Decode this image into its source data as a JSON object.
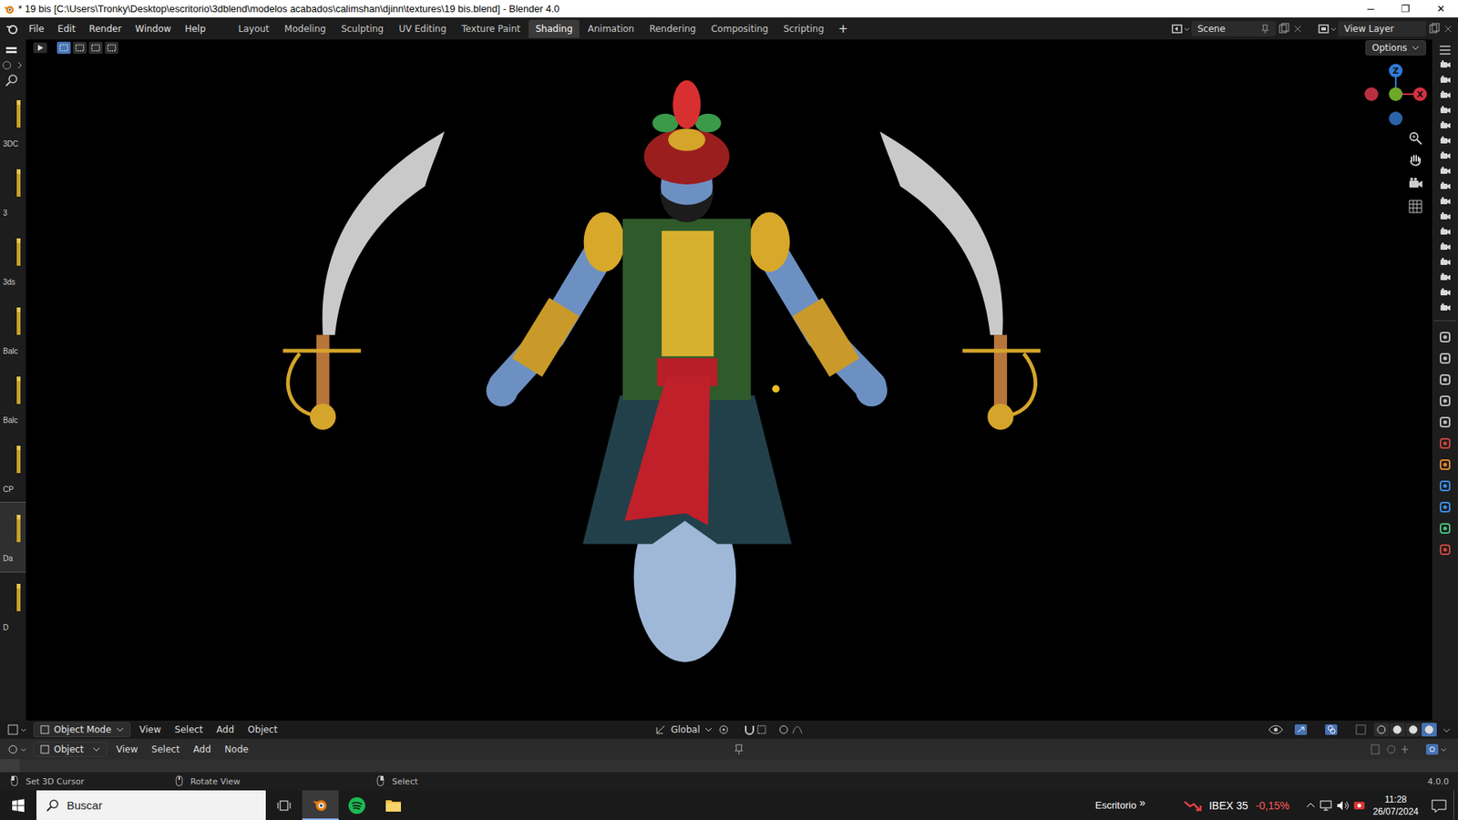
{
  "window": {
    "title": "* 19 bis [C:\\Users\\Tronky\\Desktop\\escritorio\\3dblend\\modelos acabados\\calimshan\\djinn\\textures\\19 bis.blend] - Blender 4.0",
    "controls": [
      "─",
      "❐",
      "✕"
    ]
  },
  "menu": [
    "File",
    "Edit",
    "Render",
    "Window",
    "Help"
  ],
  "workspaces": [
    {
      "label": "Layout",
      "selected": false
    },
    {
      "label": "Modeling",
      "selected": false
    },
    {
      "label": "Sculpting",
      "selected": false
    },
    {
      "label": "UV Editing",
      "selected": false
    },
    {
      "label": "Texture Paint",
      "selected": false
    },
    {
      "label": "Shading",
      "selected": true
    },
    {
      "label": "Animation",
      "selected": false
    },
    {
      "label": "Rendering",
      "selected": false
    },
    {
      "label": "Compositing",
      "selected": false
    },
    {
      "label": "Scripting",
      "selected": false
    }
  ],
  "add_workspace": "+",
  "scene": "Scene",
  "view_layer": "View Layer",
  "file_strip": [
    {
      "label": "3DC",
      "selected": false
    },
    {
      "label": "3",
      "selected": false
    },
    {
      "label": "3ds",
      "selected": false
    },
    {
      "label": "Balc",
      "selected": false
    },
    {
      "label": "Balc",
      "selected": false
    },
    {
      "label": "CP",
      "selected": false
    },
    {
      "label": "Da",
      "selected": true
    },
    {
      "label": "D",
      "selected": false
    }
  ],
  "viewport": {
    "options": "Options",
    "gizmo": {
      "z": "Z",
      "x": "X"
    }
  },
  "viewport_header": {
    "mode": "Object Mode",
    "menus": [
      "View",
      "Select",
      "Add",
      "Object"
    ],
    "orientation": "Global"
  },
  "node_header": {
    "mode": "Object",
    "menus": [
      "View",
      "Select",
      "Add",
      "Node"
    ]
  },
  "status_bar": {
    "hints": [
      "Set 3D Cursor",
      "Rotate View",
      "Select"
    ],
    "version": "4.0.0"
  },
  "taskbar": {
    "search": "Buscar",
    "toolbar": "Escritorio",
    "chevron": "»",
    "ticker": {
      "name": "IBEX 35",
      "change": "-0,15%"
    },
    "time": "11:28",
    "date": "26/07/2024"
  }
}
